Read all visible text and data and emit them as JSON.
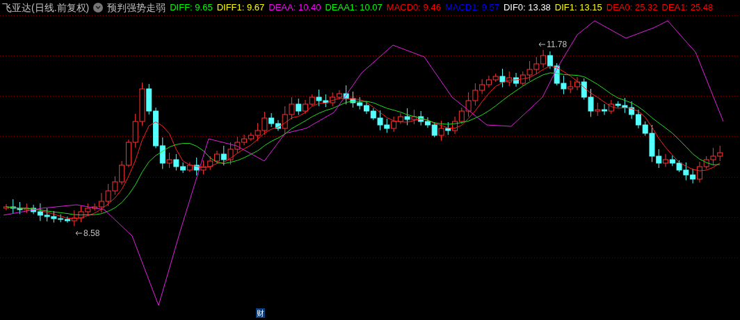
{
  "header": {
    "title": "飞亚达(日线.前复权)",
    "indicator_name": "预判强势走弱",
    "readings": [
      {
        "text": "DIFF: 9.65",
        "color": "#00ff00"
      },
      {
        "text": "DIFF1: 9.67",
        "color": "#ffff00"
      },
      {
        "text": "DEAA: 10.40",
        "color": "#ff00ff"
      },
      {
        "text": "DEAA1: 10.07",
        "color": "#00ff00"
      },
      {
        "text": "MACD0: 9.46",
        "color": "#ff0000"
      },
      {
        "text": "MACD1: 9.57",
        "color": "#0000ff"
      },
      {
        "text": "DIF0: 13.38",
        "color": "#ffffff"
      },
      {
        "text": "DIF1: 13.15",
        "color": "#ffff00"
      },
      {
        "text": "DEA0: 25.32",
        "color": "#ff0000"
      },
      {
        "text": "DEA1: 25.48",
        "color": "#ff0000"
      }
    ]
  },
  "chart": {
    "high_label": "11.78",
    "low_label": "8.58",
    "finance_badge": "财"
  }
}
